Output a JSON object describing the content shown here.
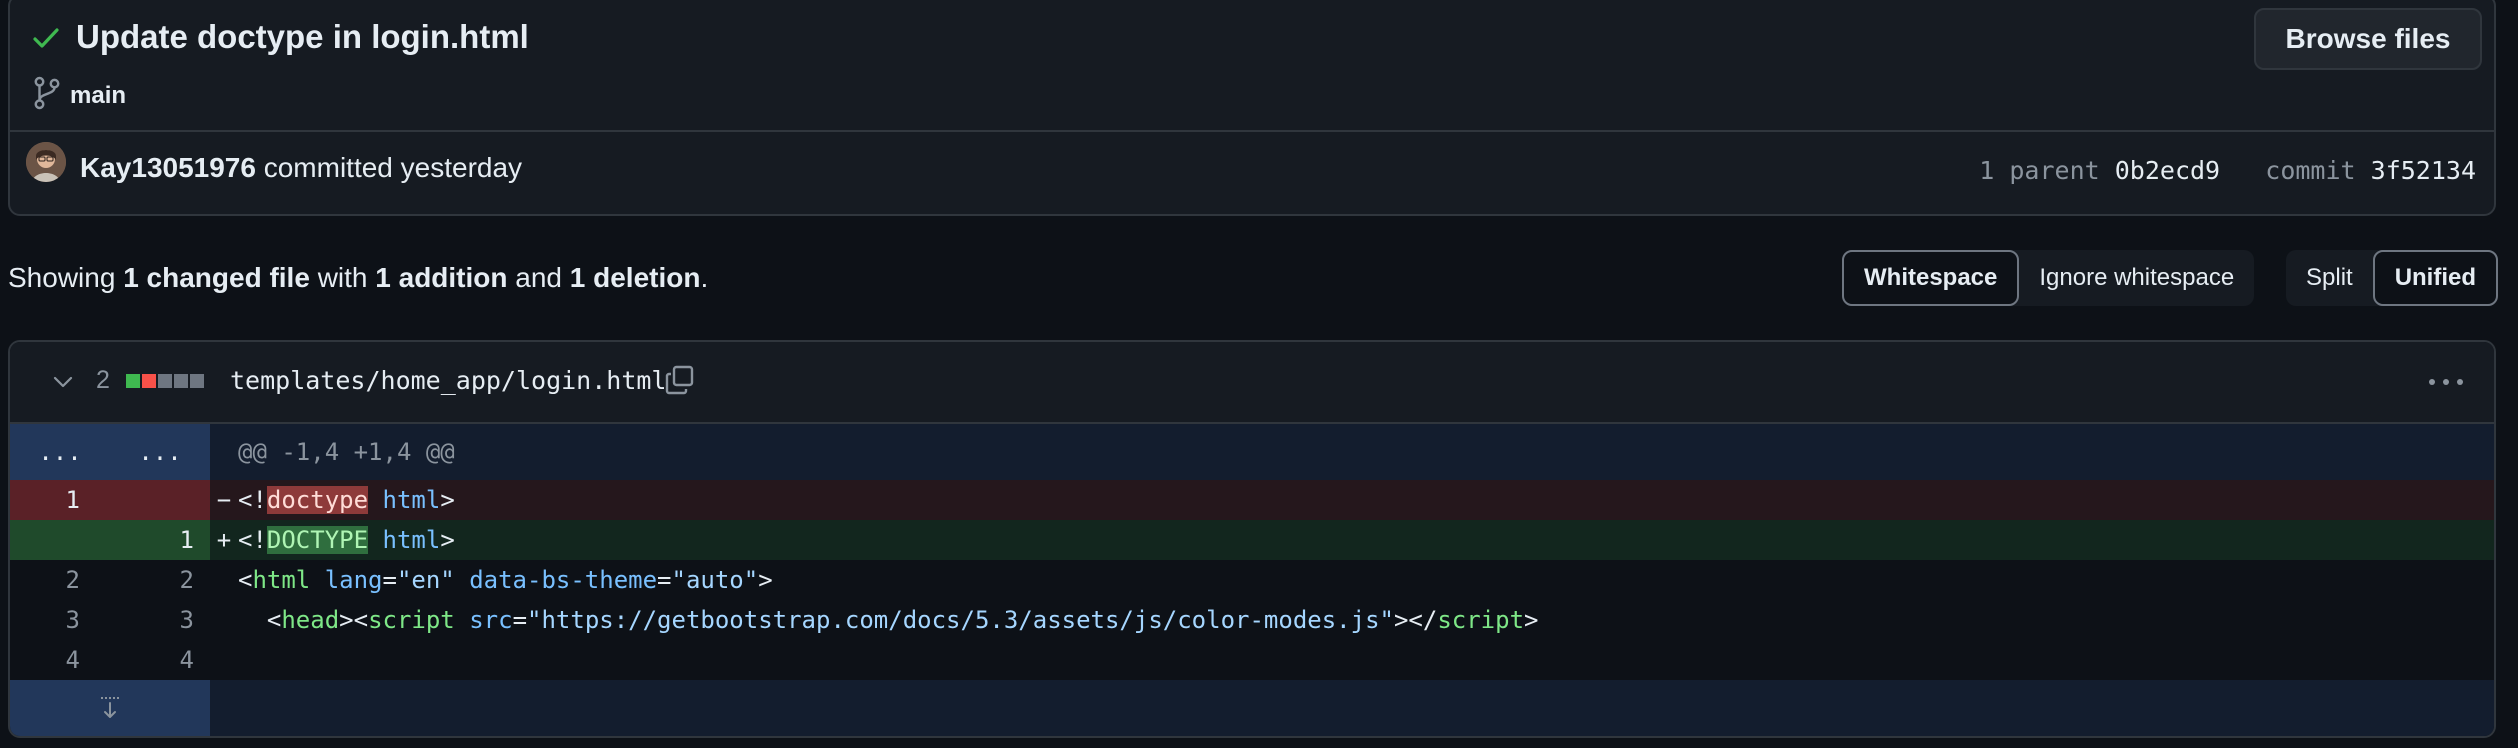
{
  "commit": {
    "title": "Update doctype in login.html",
    "branch": "main",
    "browse_label": "Browse files",
    "author": "Kay13051976",
    "committed_text": "committed yesterday",
    "parent_label": "1 parent",
    "parent_sha": "0b2ecd9",
    "commit_label": "commit",
    "commit_sha": "3f52134"
  },
  "summary": {
    "prefix": "Showing",
    "files": "1 changed file",
    "with": "with",
    "additions": "1 addition",
    "and": "and",
    "deletions": "1 deletion",
    "period": "."
  },
  "toolbar": {
    "whitespace": "Whitespace",
    "ignore_whitespace": "Ignore whitespace",
    "split": "Split",
    "unified": "Unified"
  },
  "file": {
    "change_count": "2",
    "path": "templates/home_app/login.html",
    "hunk_header": "@@ -1,4 +1,4 @@",
    "hunk_left": "...",
    "hunk_right": "...",
    "lines": [
      {
        "type": "del",
        "old": "1",
        "new": "",
        "sign": "−"
      },
      {
        "type": "add",
        "old": "",
        "new": "1",
        "sign": "+"
      },
      {
        "type": "ctx",
        "old": "2",
        "new": "2",
        "sign": ""
      },
      {
        "type": "ctx",
        "old": "3",
        "new": "3",
        "sign": ""
      },
      {
        "type": "ctx",
        "old": "4",
        "new": "4",
        "sign": ""
      }
    ],
    "code": {
      "del_open": "<!",
      "del_kw": "doctype",
      "del_rest": " html",
      "del_close": ">",
      "add_open": "<!",
      "add_kw": "DOCTYPE",
      "add_rest": " html",
      "add_close": ">",
      "l2_open": "<",
      "l2_tag": "html",
      "l2_attr1": " lang",
      "l2_eq1": "=",
      "l2_val1": "\"en\"",
      "l2_attr2": " data-bs-theme",
      "l2_eq2": "=",
      "l2_val2": "\"auto\"",
      "l2_close": ">",
      "l3_indent": "  ",
      "l3_open": "<",
      "l3_tag1": "head",
      "l3_mid": "><",
      "l3_tag2": "script",
      "l3_attr": " src",
      "l3_eq": "=",
      "l3_val": "\"https://getbootstrap.com/docs/5.3/assets/js/color-modes.js\"",
      "l3_mid2": "></",
      "l3_tag3": "script",
      "l3_close": ">"
    }
  },
  "colors": {
    "added": "#3fb950",
    "deleted": "#f85149",
    "neutral": "#6e7681"
  }
}
